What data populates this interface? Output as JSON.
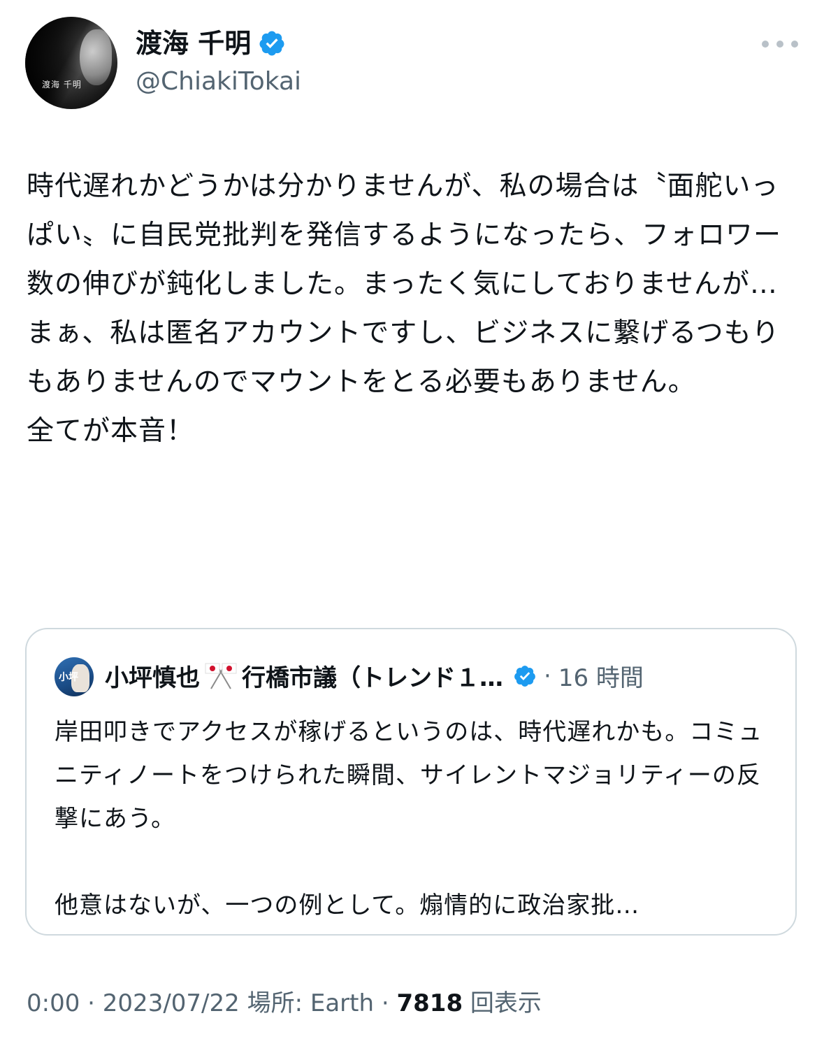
{
  "author": {
    "display_name": "渡海 千明",
    "handle": "@ChiakiTokai",
    "avatar_signature": "渡海 千明"
  },
  "tweet": {
    "text": "時代遅れかどうかは分かりませんが、私の場合は〝面舵いっぱい〟に自民党批判を発信するようになったら、フォロワー数の伸びが鈍化しました。まったく気にしておりませんが…\nまぁ、私は匿名アカウントですし、ビジネスに繋げるつもりもありませんのでマウントをとる必要もありません。\n全てが本音！"
  },
  "quoted_tweet": {
    "display_name": "小坪慎也",
    "display_name_suffix": "行橋市議（トレンド１…",
    "avatar_text": "小坪",
    "time": "16 時間",
    "text": "岸田叩きでアクセスが稼げるというのは、時代遅れかも。コミュニティノートをつけられた瞬間、サイレントマジョリティーの反撃にあう。\n\n他意はないが、一つの例として。煽情的に政治家批…"
  },
  "meta": {
    "time": "0:00",
    "date": "2023/07/22",
    "location_label": "場所: Earth",
    "views_count": "7818",
    "views_label": "回表示"
  },
  "colors": {
    "verified": "#1d9bf0",
    "secondary_text": "#536471",
    "border": "#cfd9de"
  },
  "icons": [
    "verified-badge-icon",
    "more-options-icon",
    "japan-flag-icon"
  ]
}
